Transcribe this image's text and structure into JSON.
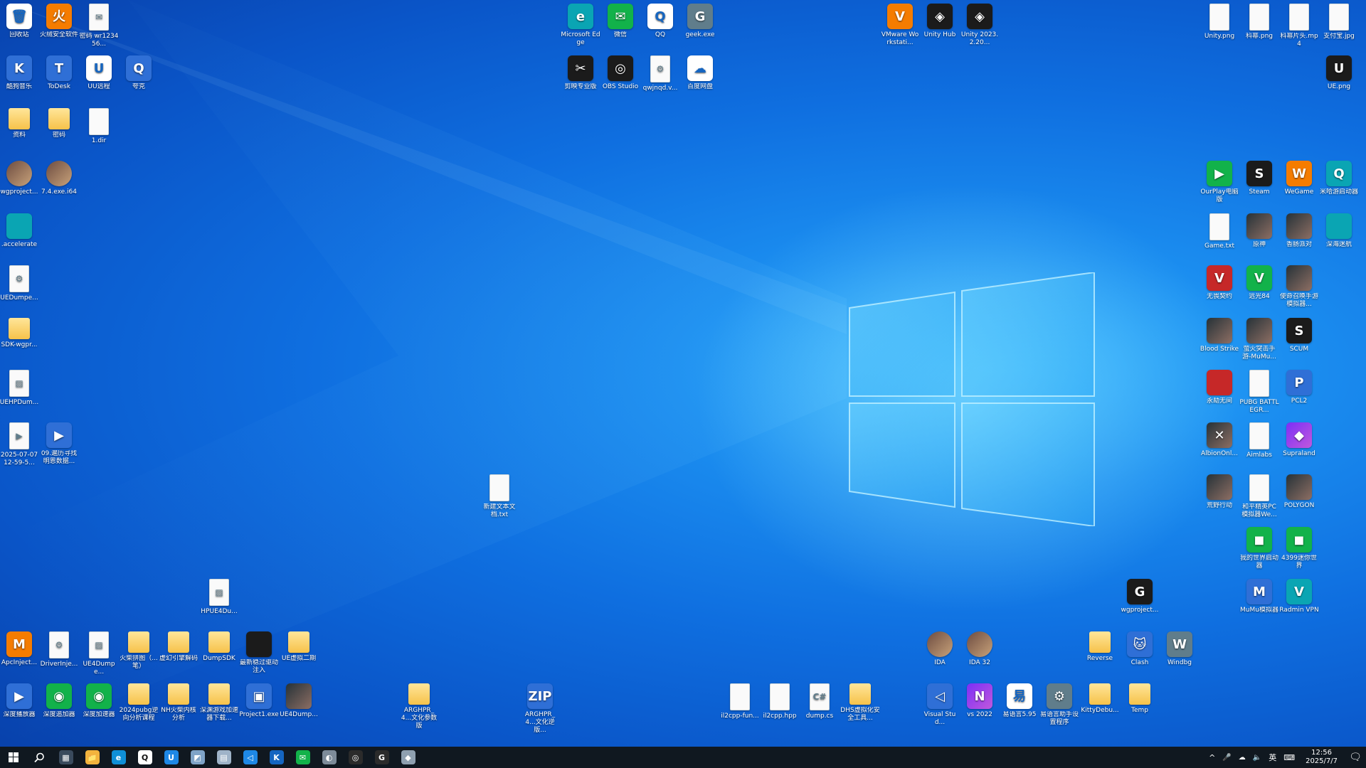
{
  "desktop": {
    "icons": [
      {
        "label": "回收站",
        "style": "s-white",
        "glyph": "🗑"
      },
      {
        "label": "火绒安全软件",
        "style": "s-orange",
        "glyph": "火"
      },
      {
        "label": "密码 wr123456...",
        "style": "s-file",
        "glyph": "✉"
      },
      {
        "label": "酷狗音乐",
        "style": "s-app",
        "glyph": "K"
      },
      {
        "label": "ToDesk",
        "style": "s-app",
        "glyph": "T"
      },
      {
        "label": "UU远程",
        "style": "s-white",
        "glyph": "U"
      },
      {
        "label": "夸克",
        "style": "s-app",
        "glyph": "Q"
      },
      {
        "label": "资料",
        "style": "s-folder",
        "glyph": ""
      },
      {
        "label": "密码",
        "style": "s-folder",
        "glyph": ""
      },
      {
        "label": "1.dir",
        "style": "s-file",
        "glyph": ""
      },
      {
        "label": "wgproject...",
        "style": "s-photo",
        "glyph": ""
      },
      {
        "label": "7.4.exe.i64",
        "style": "s-photo",
        "glyph": ""
      },
      {
        "label": ".accelerate",
        "style": "s-teal",
        "glyph": ""
      },
      {
        "label": "UEDumpe...",
        "style": "s-file",
        "glyph": "⚙"
      },
      {
        "label": "SDK-wgpr...",
        "style": "s-folder",
        "glyph": ""
      },
      {
        "label": "UEHPDum...",
        "style": "s-file",
        "glyph": "▨"
      },
      {
        "label": "2025-07-07 12-59-5...",
        "style": "s-file",
        "glyph": "▶"
      },
      {
        "label": "09.遍历寻找 明恩数据...",
        "style": "s-app",
        "glyph": "▶"
      },
      {
        "label": "Microsoft Edge",
        "style": "s-teal",
        "glyph": "e"
      },
      {
        "label": "微信",
        "style": "s-green",
        "glyph": "✉"
      },
      {
        "label": "QQ",
        "style": "s-white",
        "glyph": "Q"
      },
      {
        "label": "geek.exe",
        "style": "s-gray",
        "glyph": "G"
      },
      {
        "label": "剪映专业版",
        "style": "s-dark",
        "glyph": "✂"
      },
      {
        "label": "OBS Studio",
        "style": "s-dark",
        "glyph": "◎"
      },
      {
        "label": "qwjnqd.v...",
        "style": "s-file",
        "glyph": "⚙"
      },
      {
        "label": "百度网盘",
        "style": "s-white",
        "glyph": "☁"
      },
      {
        "label": "VMware Workstati...",
        "style": "s-orange",
        "glyph": "V"
      },
      {
        "label": "Unity Hub",
        "style": "s-dark",
        "glyph": "◈"
      },
      {
        "label": "Unity 2023.2.20...",
        "style": "s-dark",
        "glyph": "◈"
      },
      {
        "label": "Unity.png",
        "style": "s-file",
        "glyph": ""
      },
      {
        "label": "科幂.png",
        "style": "s-file",
        "glyph": ""
      },
      {
        "label": "科幂片头.mp4",
        "style": "s-file",
        "glyph": ""
      },
      {
        "label": "支付宝.jpg",
        "style": "s-file",
        "glyph": ""
      },
      {
        "label": "UE.png",
        "style": "s-dark",
        "glyph": "U"
      },
      {
        "label": "OurPlay电脑版",
        "style": "s-green",
        "glyph": "▶"
      },
      {
        "label": "Steam",
        "style": "s-dark",
        "glyph": "S"
      },
      {
        "label": "WeGame",
        "style": "s-orange",
        "glyph": "W"
      },
      {
        "label": "米哈游启动器",
        "style": "s-teal",
        "glyph": "Q"
      },
      {
        "label": "Game.txt",
        "style": "s-file",
        "glyph": ""
      },
      {
        "label": "原神",
        "style": "s-game",
        "glyph": ""
      },
      {
        "label": "香肠派对",
        "style": "s-game",
        "glyph": ""
      },
      {
        "label": "深海迷航",
        "style": "s-teal",
        "glyph": ""
      },
      {
        "label": "无畏契约",
        "style": "s-red",
        "glyph": "V"
      },
      {
        "label": "远光84",
        "style": "s-green",
        "glyph": "V"
      },
      {
        "label": "使命召唤手游模拟器...",
        "style": "s-game",
        "glyph": ""
      },
      {
        "label": "Blood Strike",
        "style": "s-game",
        "glyph": ""
      },
      {
        "label": "萤火突击手游-MuMu...",
        "style": "s-game",
        "glyph": ""
      },
      {
        "label": "SCUM",
        "style": "s-dark",
        "glyph": "S"
      },
      {
        "label": "永劫无间",
        "style": "s-red",
        "glyph": ""
      },
      {
        "label": "PUBG BATTLEGR...",
        "style": "s-file",
        "glyph": ""
      },
      {
        "label": "PCL2",
        "style": "s-app",
        "glyph": "P"
      },
      {
        "label": "AlbionOnl...",
        "style": "s-game",
        "glyph": "✕"
      },
      {
        "label": "Aimlabs",
        "style": "s-file",
        "glyph": ""
      },
      {
        "label": "Supraland",
        "style": "s-purple",
        "glyph": "◆"
      },
      {
        "label": "荒野行动",
        "style": "s-game",
        "glyph": ""
      },
      {
        "label": "和平精英PC模拟器We...",
        "style": "s-file",
        "glyph": ""
      },
      {
        "label": "POLYGON",
        "style": "s-game",
        "glyph": ""
      },
      {
        "label": "我的世界启动器",
        "style": "s-green",
        "glyph": "◼"
      },
      {
        "label": "4399迷你世界",
        "style": "s-green",
        "glyph": "◼"
      },
      {
        "label": "MuMu模拟器",
        "style": "s-app",
        "glyph": "M"
      },
      {
        "label": "Radmin VPN",
        "style": "s-teal",
        "glyph": "V"
      },
      {
        "label": "新建文本文档.txt",
        "style": "s-file",
        "glyph": ""
      },
      {
        "label": "HPUE4Du...",
        "style": "s-file",
        "glyph": "▨"
      },
      {
        "label": "wgproject...",
        "style": "s-dark",
        "glyph": "G"
      },
      {
        "label": "ApcInject...",
        "style": "s-orange",
        "glyph": "M"
      },
      {
        "label": "DriverInje...",
        "style": "s-file",
        "glyph": "⚙"
      },
      {
        "label": "UE4Dumpe...",
        "style": "s-file",
        "glyph": "▨"
      },
      {
        "label": "火柴拼图（...笔）",
        "style": "s-folder",
        "glyph": ""
      },
      {
        "label": "虚幻引擎解码",
        "style": "s-folder",
        "glyph": ""
      },
      {
        "label": "DumpSDK",
        "style": "s-folder",
        "glyph": ""
      },
      {
        "label": "最新稳过驱动注入",
        "style": "s-dark",
        "glyph": ""
      },
      {
        "label": "UE虚拟二期",
        "style": "s-folder",
        "glyph": ""
      },
      {
        "label": "IDA",
        "style": "s-photo",
        "glyph": ""
      },
      {
        "label": "IDA 32",
        "style": "s-photo",
        "glyph": ""
      },
      {
        "label": "Reverse",
        "style": "s-folder",
        "glyph": ""
      },
      {
        "label": "Clash",
        "style": "s-app",
        "glyph": "🐱"
      },
      {
        "label": "Windbg",
        "style": "s-gray",
        "glyph": "W"
      },
      {
        "label": "深度播放器",
        "style": "s-app",
        "glyph": "▶"
      },
      {
        "label": "深度追加器",
        "style": "s-green",
        "glyph": "◉"
      },
      {
        "label": "深度加速器",
        "style": "s-green",
        "glyph": "◉"
      },
      {
        "label": "2024pubg逆向分析课程",
        "style": "s-folder",
        "glyph": ""
      },
      {
        "label": "NH火柴内核分析",
        "style": "s-folder",
        "glyph": ""
      },
      {
        "label": "深渊游戏加速器下载...",
        "style": "s-folder",
        "glyph": ""
      },
      {
        "label": "Project1.exe",
        "style": "s-app",
        "glyph": "▣"
      },
      {
        "label": "UE4Dump...",
        "style": "s-game",
        "glyph": ""
      },
      {
        "label": "ARGHPR_4...文化参数版",
        "style": "s-folder",
        "glyph": ""
      },
      {
        "label": "ARGHPR_4...文化逆版...",
        "style": "s-app",
        "glyph": "ZIP"
      },
      {
        "label": "il2cpp-fun...",
        "style": "s-file",
        "glyph": ""
      },
      {
        "label": "il2cpp.hpp",
        "style": "s-file",
        "glyph": ""
      },
      {
        "label": "dump.cs",
        "style": "s-file",
        "glyph": "C#"
      },
      {
        "label": "DHS虚拟化安全工具...",
        "style": "s-folder",
        "glyph": ""
      },
      {
        "label": "Visual Stud...",
        "style": "s-app",
        "glyph": "◁"
      },
      {
        "label": "vs 2022",
        "style": "s-purple",
        "glyph": "N"
      },
      {
        "label": "易语言5.95",
        "style": "s-white",
        "glyph": "易"
      },
      {
        "label": "易语言助手设置程序",
        "style": "s-gray",
        "glyph": "⚙"
      },
      {
        "label": "KittyDebu...",
        "style": "s-folder",
        "glyph": ""
      },
      {
        "label": "Temp",
        "style": "s-folder",
        "glyph": ""
      }
    ]
  },
  "taskbar": {
    "apps": [
      {
        "name": "task-view",
        "glyph": "▦",
        "color": "#3a4a5c"
      },
      {
        "name": "file-explorer",
        "glyph": "📁",
        "color": "#f2b33d"
      },
      {
        "name": "edge",
        "glyph": "e",
        "color": "#0f8fd6"
      },
      {
        "name": "qq",
        "glyph": "Q",
        "color": "#ffffff"
      },
      {
        "name": "uu-remote",
        "glyph": "U",
        "color": "#1e88e5"
      },
      {
        "name": "app-6",
        "glyph": "◩",
        "color": "#7fa3c7"
      },
      {
        "name": "app-7",
        "glyph": "▤",
        "color": "#9fb3c8"
      },
      {
        "name": "vscode",
        "glyph": "◁",
        "color": "#1e88e5"
      },
      {
        "name": "kugou",
        "glyph": "K",
        "color": "#1565c0"
      },
      {
        "name": "wechat",
        "glyph": "✉",
        "color": "#12b24a"
      },
      {
        "name": "app-11",
        "glyph": "◐",
        "color": "#7d8b99"
      },
      {
        "name": "obs",
        "glyph": "◎",
        "color": "#2b2b2b"
      },
      {
        "name": "wgproject",
        "glyph": "G",
        "color": "#2b2b2b"
      },
      {
        "name": "app-14",
        "glyph": "◆",
        "color": "#8fa0b0"
      }
    ],
    "tray": {
      "chevron": "^",
      "mic": "🎤",
      "network": "☁",
      "volume": "🔈",
      "ime": "英",
      "keyboard": "⌨",
      "time": "12:56",
      "date": "2025/7/7",
      "notification": "🗨"
    }
  }
}
